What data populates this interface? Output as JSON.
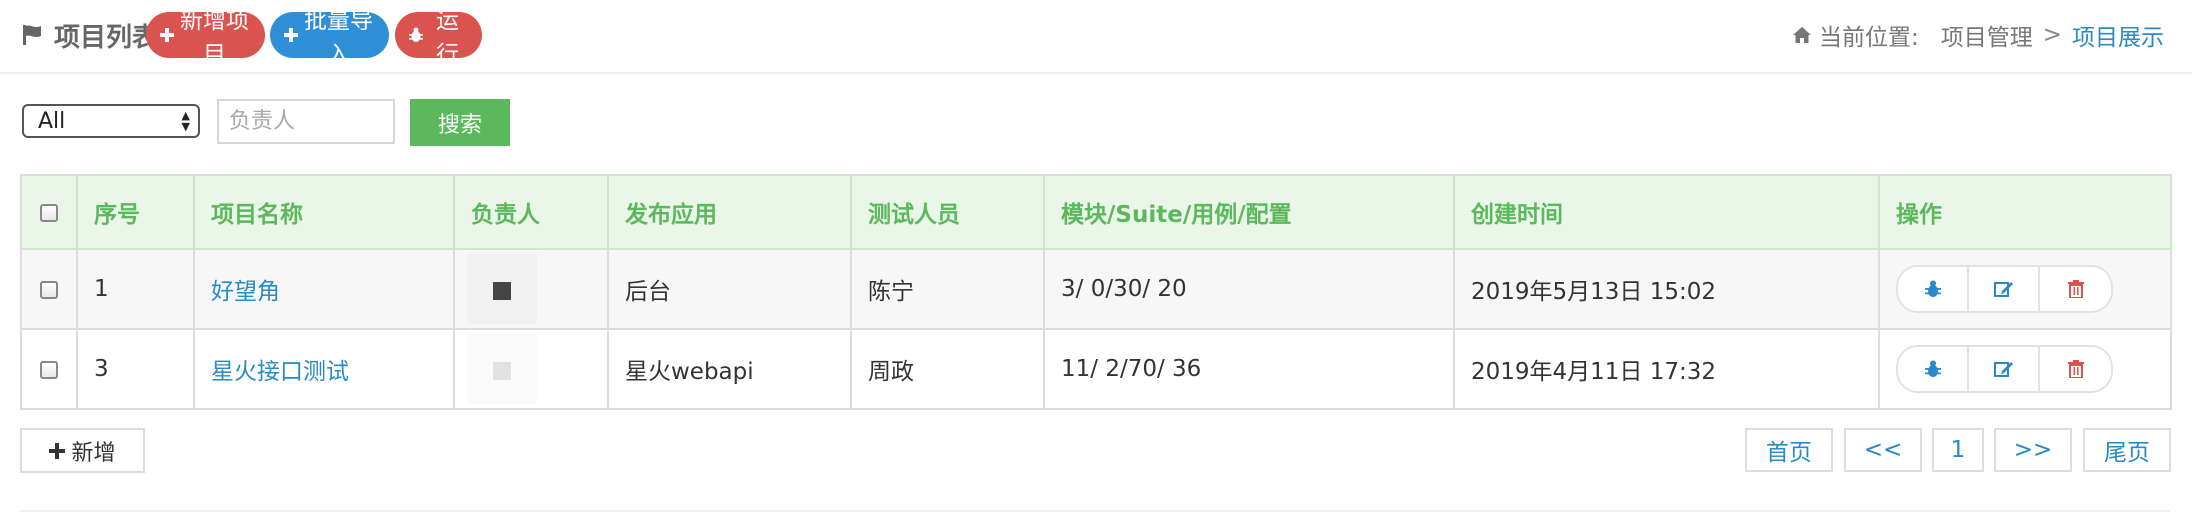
{
  "header": {
    "title": "项目列表",
    "buttons": {
      "add_project": "新增项目",
      "batch_import": "批量导入",
      "run": "运行"
    },
    "breadcrumb": {
      "prefix": "当前位置:",
      "parent": "项目管理",
      "separator": ">",
      "current": "项目展示"
    }
  },
  "filter": {
    "select_value": "All",
    "owner_placeholder": "负责人",
    "search_label": "搜索"
  },
  "table": {
    "columns": [
      "序号",
      "项目名称",
      "负责人",
      "发布应用",
      "测试人员",
      "模块/Suite/用例/配置",
      "创建时间",
      "操作"
    ],
    "rows": [
      {
        "id": "1",
        "name": "好望角",
        "owner": "",
        "app": "后台",
        "tester": "陈宁",
        "stats": "3/ 0/30/ 20",
        "created": "2019年5月13日 15:02"
      },
      {
        "id": "3",
        "name": "星火接口测试",
        "owner": "",
        "app": "星火webapi",
        "tester": "周政",
        "stats": "11/ 2/70/ 36",
        "created": "2019年4月11日 17:32"
      }
    ],
    "action_icons": [
      "bug-icon",
      "edit-icon",
      "trash-icon"
    ]
  },
  "footer": {
    "add_label": "新增",
    "pager": {
      "first": "首页",
      "prev": "<<",
      "page": "1",
      "next": ">>",
      "last": "尾页"
    }
  },
  "colors": {
    "red": "#d9534f",
    "blue": "#2f8fd6",
    "green": "#5cb85c",
    "link": "#2a8ac6",
    "header_bg": "#eaf6e7"
  }
}
